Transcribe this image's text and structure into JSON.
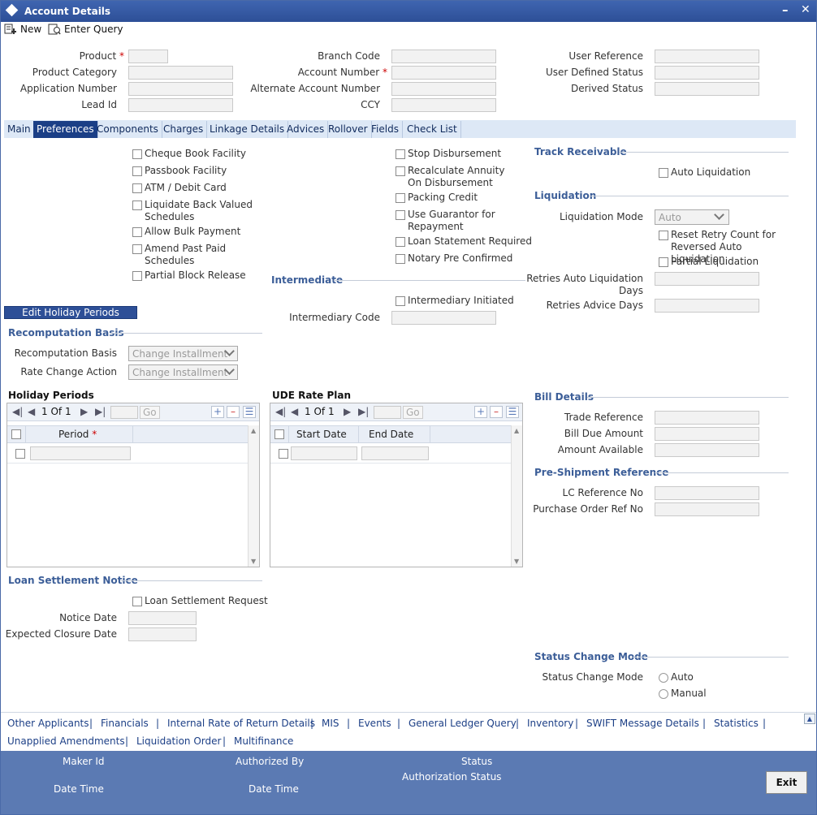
{
  "window": {
    "title": "Account Details",
    "minimize": "–",
    "close": "✕"
  },
  "toolbar": {
    "new_label": "New",
    "enter_query_label": "Enter Query"
  },
  "header": {
    "product": "Product",
    "product_category": "Product Category",
    "application_number": "Application Number",
    "lead_id": "Lead Id",
    "branch_code": "Branch Code",
    "account_number": "Account Number",
    "alternate_account_number": "Alternate Account Number",
    "ccy": "CCY",
    "user_reference": "User Reference",
    "user_defined_status": "User Defined Status",
    "derived_status": "Derived Status",
    "required_mark": "*"
  },
  "tabs": [
    "Main",
    "Preferences",
    "Components",
    "Charges",
    "Linkage Details",
    "Advices",
    "Rollover",
    "Fields",
    "Check List"
  ],
  "preferences": {
    "col1": [
      "Cheque Book Facility",
      "Passbook Facility",
      "ATM / Debit Card",
      "Liquidate Back Valued Schedules",
      "Allow Bulk Payment",
      "Amend Past Paid Schedules",
      "Partial Block Release"
    ],
    "col2": [
      "Stop Disbursement",
      "Recalculate Annuity On Disbursement",
      "Packing Credit",
      "Use Guarantor for Repayment",
      "Loan Statement Required",
      "Notary Pre Confirmed"
    ]
  },
  "intermediate": {
    "title": "Intermediate",
    "initiated": "Intermediary Initiated",
    "code_label": "Intermediary Code"
  },
  "track_receivable": {
    "title": "Track Receivable",
    "auto_liquidation": "Auto Liquidation"
  },
  "liquidation": {
    "title": "Liquidation",
    "mode_label": "Liquidation Mode",
    "mode_value": "Auto",
    "reset_retry": "Reset Retry Count for Reversed Auto Liquidation",
    "partial": "Partial Liquidation",
    "retries_auto_label": "Retries Auto Liquidation Days",
    "retries_advice_label": "Retries Advice Days"
  },
  "edit_holiday_button": "Edit Holiday Periods",
  "recomputation": {
    "title": "Recomputation Basis",
    "basis_label": "Recomputation Basis",
    "basis_value": "Change Installment",
    "rate_change_label": "Rate Change Action",
    "rate_change_value": "Change Installment"
  },
  "holiday_periods": {
    "title": "Holiday Periods",
    "page": "1",
    "of": "Of",
    "total": "1",
    "go": "Go",
    "col_period": "Period"
  },
  "ude_rate_plan": {
    "title": "UDE Rate Plan",
    "page": "1",
    "of": "Of",
    "total": "1",
    "go": "Go",
    "col_start": "Start Date",
    "col_end": "End Date"
  },
  "bill_details": {
    "title": "Bill Details",
    "trade_reference": "Trade Reference",
    "bill_due_amount": "Bill Due Amount",
    "amount_available": "Amount Available"
  },
  "pre_shipment": {
    "title": "Pre-Shipment Reference",
    "lc_reference": "LC Reference No",
    "po_ref": "Purchase Order Ref No"
  },
  "loan_settlement": {
    "title": "Loan Settlement Notice",
    "request": "Loan Settlement Request",
    "notice_date": "Notice Date",
    "expected_closure": "Expected Closure Date"
  },
  "status_change": {
    "title": "Status Change Mode",
    "label": "Status Change Mode",
    "auto": "Auto",
    "manual": "Manual"
  },
  "footer_links": {
    "row1": [
      "Other Applicants",
      "Financials",
      "Internal Rate of Return Details",
      "MIS",
      "Events",
      "General Ledger Query",
      "Inventory",
      "SWIFT Message Details",
      "Statistics"
    ],
    "row2": [
      "Unapplied Amendments",
      "Liquidation Order",
      "Multifinance"
    ],
    "sep": "|"
  },
  "statusbar": {
    "maker_id": "Maker Id",
    "date_time1": "Date Time",
    "authorized_by": "Authorized By",
    "date_time2": "Date Time",
    "status": "Status",
    "authorization_status": "Authorization Status",
    "exit": "Exit"
  },
  "colors": {
    "title_bar": "#2d4f97",
    "tab_active": "#1b3f86",
    "section": "#3c5e98",
    "status_bar": "#5b7ab3",
    "link": "#1c3f86"
  }
}
